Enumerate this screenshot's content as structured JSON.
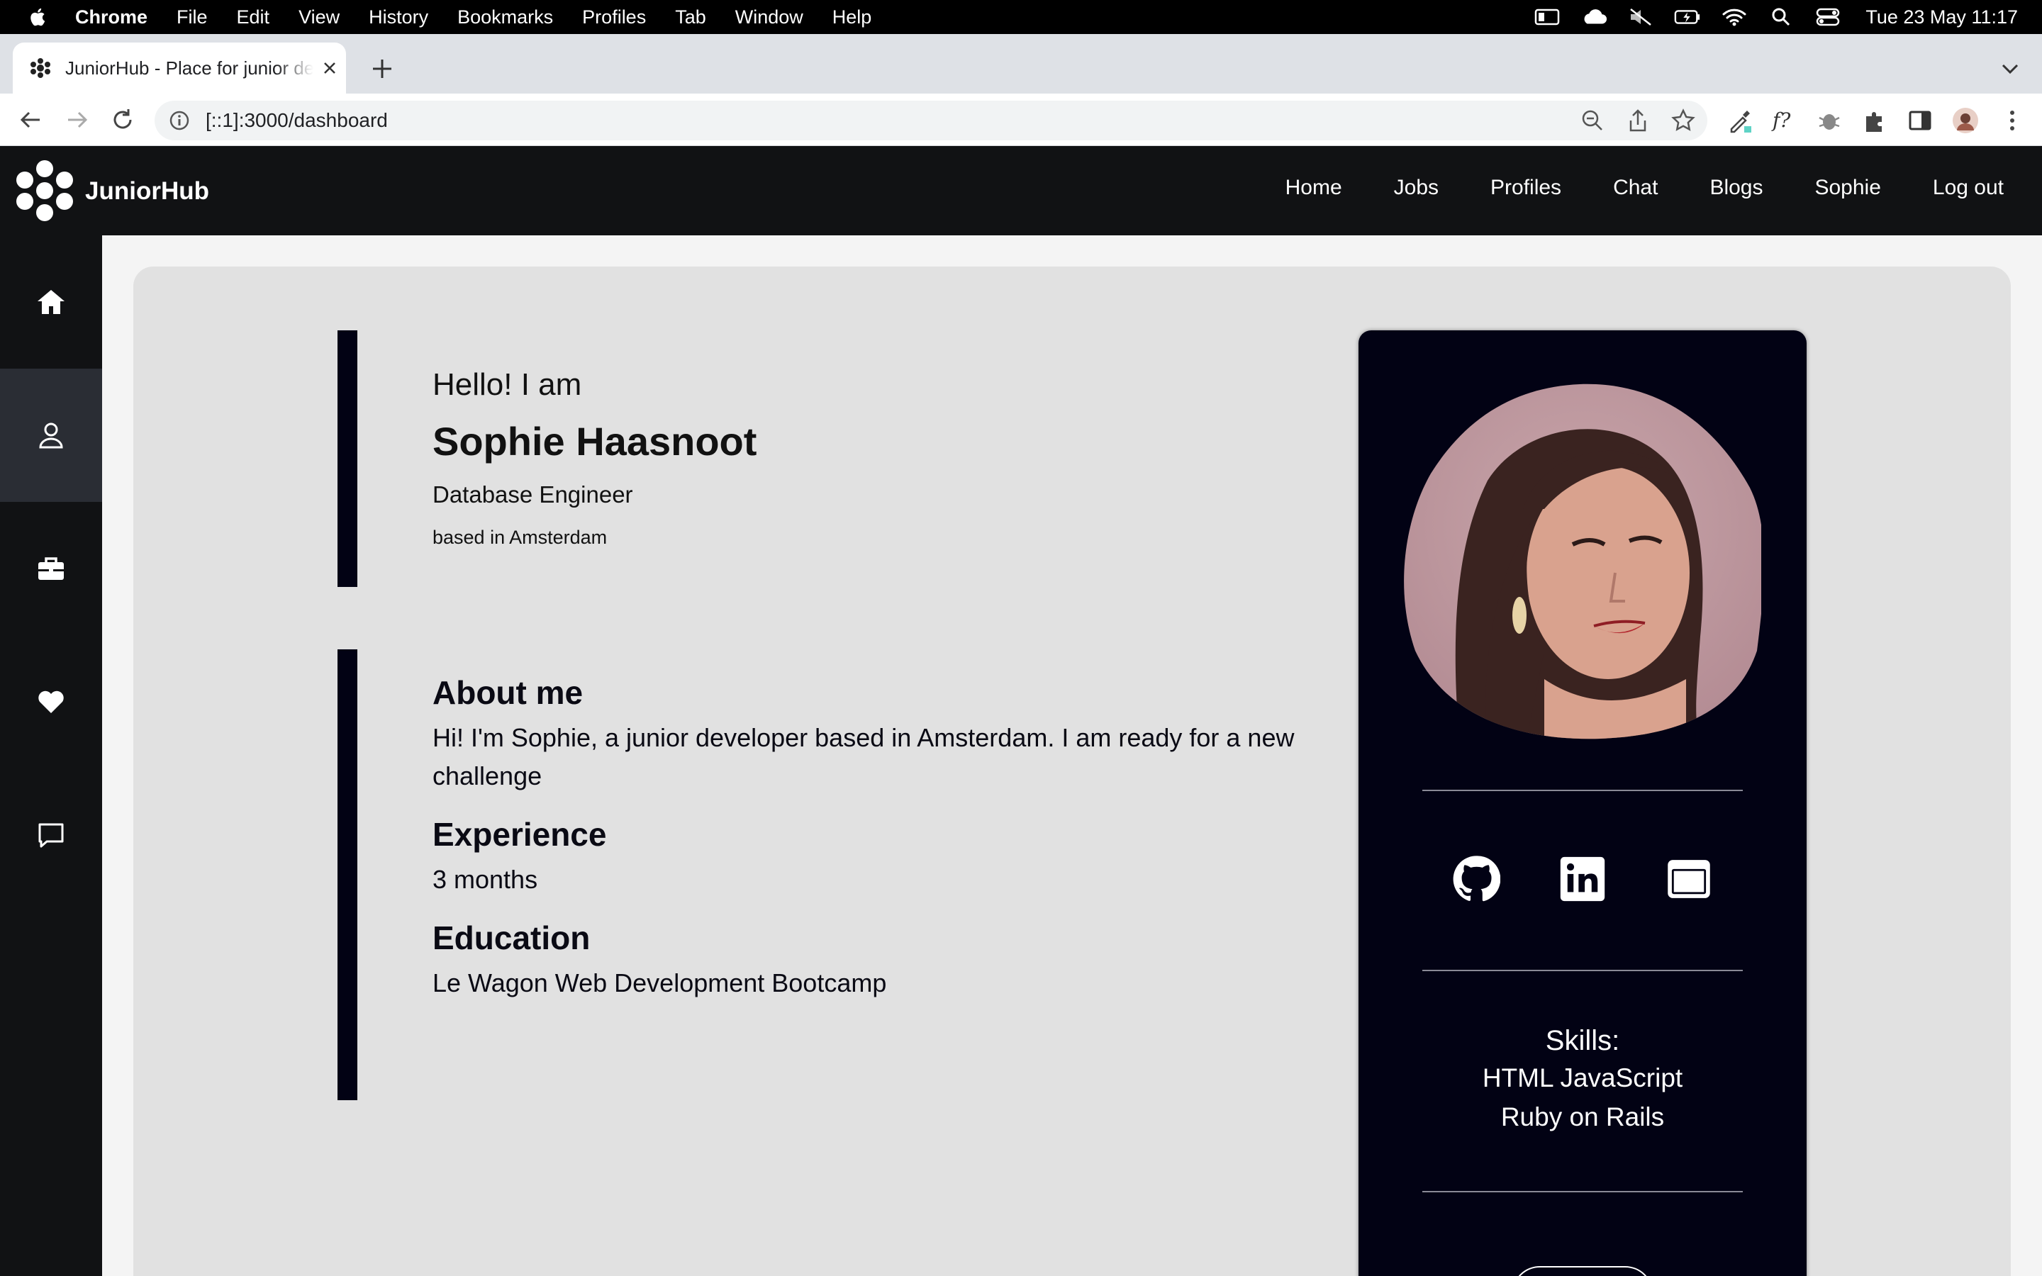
{
  "menubar": {
    "app": "Chrome",
    "items": [
      "File",
      "Edit",
      "View",
      "History",
      "Bookmarks",
      "Profiles",
      "Tab",
      "Window",
      "Help"
    ],
    "clock": "Tue 23 May  11:17"
  },
  "browser": {
    "tab_title": "JuniorHub - Place for junior developers",
    "url": "[::1]:3000/dashboard"
  },
  "site": {
    "brand": "JuniorHub",
    "nav": [
      "Home",
      "Jobs",
      "Profiles",
      "Chat",
      "Blogs",
      "Sophie",
      "Log out"
    ]
  },
  "sidebar": {
    "items": [
      {
        "icon": "home-icon",
        "active": false
      },
      {
        "icon": "user-icon",
        "active": true
      },
      {
        "icon": "briefcase-icon",
        "active": false
      },
      {
        "icon": "heart-icon",
        "active": false
      },
      {
        "icon": "chat-icon",
        "active": false
      }
    ]
  },
  "profile": {
    "greeting": "Hello! I am",
    "name": "Sophie Haasnoot",
    "role": "Database Engineer",
    "location": "based in Amsterdam",
    "about_title": "About me",
    "about_text": "Hi! I'm Sophie, a junior developer based in Amsterdam. I am ready for a new challenge",
    "experience_title": "Experience",
    "experience_text": "3 months",
    "education_title": "Education",
    "education_text": "Le Wagon Web Development Bootcamp",
    "skills_title": "Skills:",
    "skills_line1": "HTML JavaScript",
    "skills_line2": "Ruby on Rails"
  },
  "socials": [
    "github-icon",
    "linkedin-icon",
    "website-icon"
  ],
  "colors": {
    "navbar": "#111214",
    "card": "#020214",
    "panel": "#e1e1e1"
  }
}
